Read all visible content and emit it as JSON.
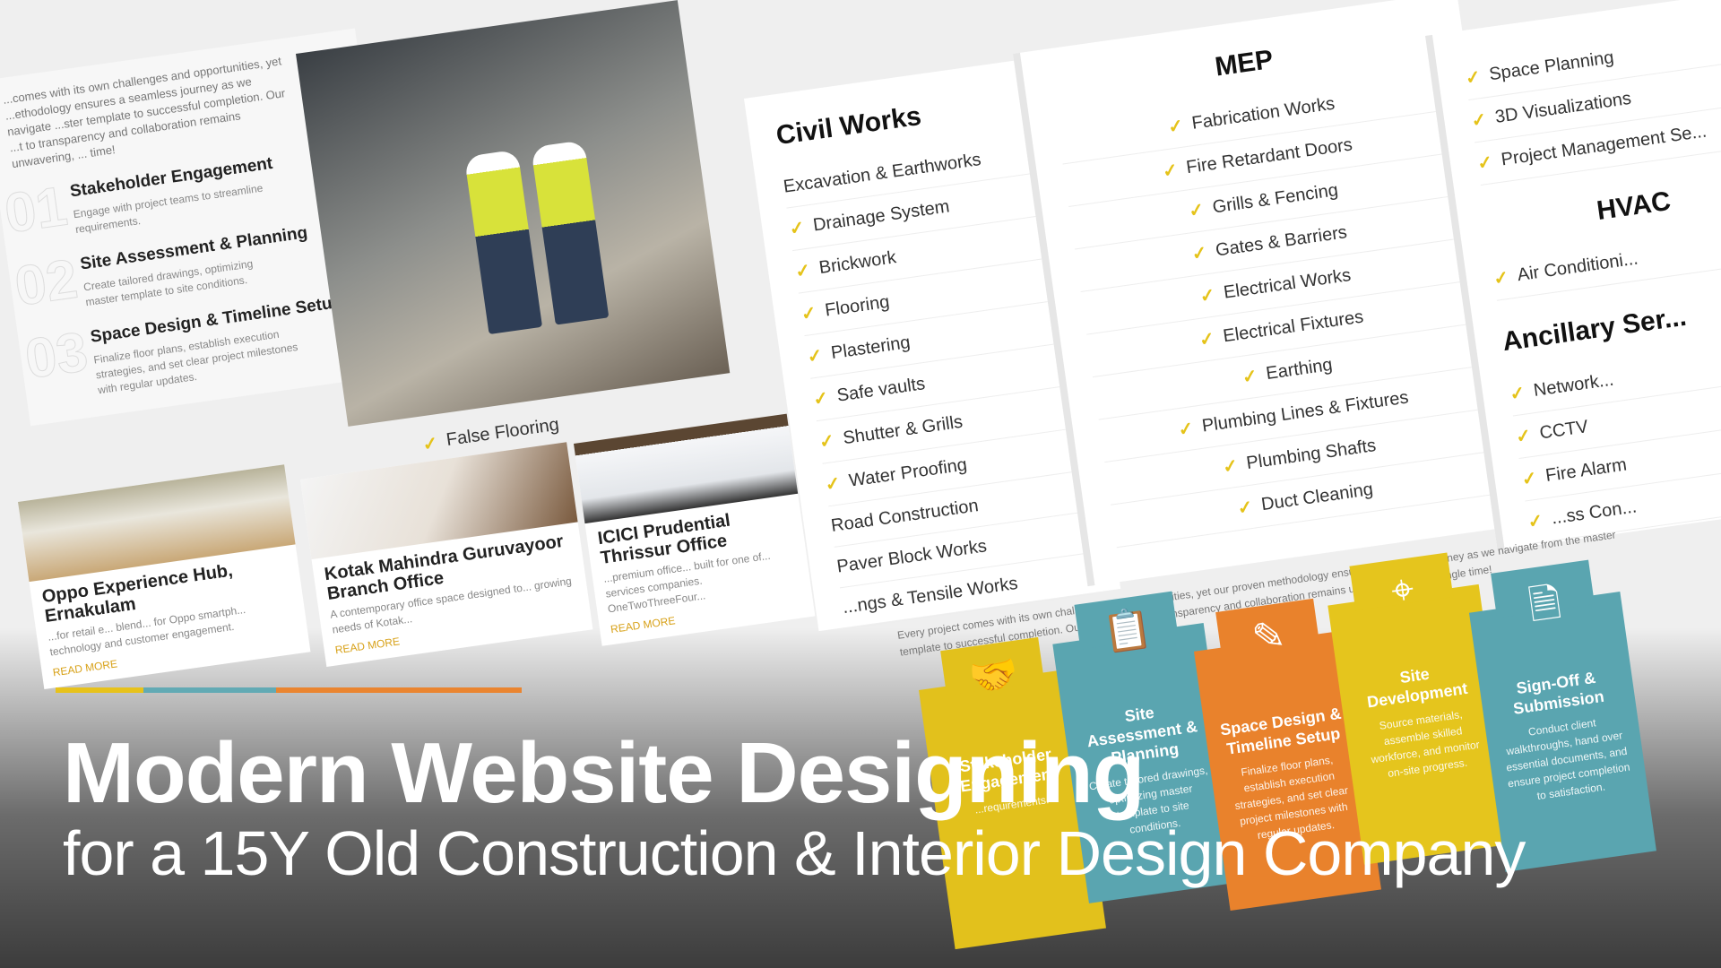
{
  "colors": {
    "yellow": "#e7c21b",
    "teal": "#62aab4",
    "orange": "#ea8530",
    "dark": "#111111"
  },
  "process": {
    "intro": "...comes with its own challenges and opportunities, yet ...ethodology ensures a seamless journey as we navigate ...ster template to successful completion. Our ...t to transparency and collaboration remains unwavering, ... time!",
    "steps": [
      {
        "num": "01",
        "title": "Stakeholder Engagement",
        "desc": "Engage with project teams to streamline requirements."
      },
      {
        "num": "02",
        "title": "Site Assessment & Planning",
        "desc": "Create tailored drawings, optimizing master template to site conditions."
      },
      {
        "num": "03",
        "title": "Space Design & Timeline Setup",
        "desc": "Finalize floor plans, establish execution strategies, and set clear project milestones with regular updates."
      }
    ],
    "partial_item": "False Flooring"
  },
  "civil": {
    "title": "Civil Works",
    "items": [
      {
        "label": "Excavation & Earthworks",
        "check": false
      },
      {
        "label": "Drainage System",
        "check": true
      },
      {
        "label": "Brickwork",
        "check": true
      },
      {
        "label": "Flooring",
        "check": true
      },
      {
        "label": "Plastering",
        "check": true
      },
      {
        "label": "Safe vaults",
        "check": true
      },
      {
        "label": "Shutter & Grills",
        "check": true
      },
      {
        "label": "Water Proofing",
        "check": true
      },
      {
        "label": "Road Construction",
        "check": false
      },
      {
        "label": "Paver Block Works",
        "check": false
      },
      {
        "label": "...ngs & Tensile Works",
        "check": false
      }
    ]
  },
  "mep": {
    "title": "MEP",
    "items": [
      "Fabrication Works",
      "Fire Retardant Doors",
      "Grills & Fencing",
      "Gates & Barriers",
      "Electrical Works",
      "Electrical Fixtures",
      "Earthing",
      "Plumbing Lines & Fixtures",
      "Plumbing Shafts",
      "Duct Cleaning"
    ]
  },
  "right": {
    "items_top": [
      "Space Planning",
      "3D Visualizations",
      "Project Management Se..."
    ],
    "hvac_title": "HVAC",
    "hvac_items": [
      "Air Conditioni..."
    ],
    "ancillary_title": "Ancillary Ser...",
    "ancillary_items": [
      "Network...",
      "CCTV",
      "Fire Alarm",
      "...ss Con..."
    ]
  },
  "methodology_text": "Every project comes with its own challenges and opportunities, yet our proven methodology ensures a seamless journey as we navigate from the master template to successful completion. Our commitment to transparency and collaboration remains unwavering, every single time!",
  "projects": [
    {
      "title": "Oppo Experience Hub, Ernakulam",
      "desc": "...for retail e... blend... for Oppo smartph... technology and customer engagement.",
      "link": "READ MORE"
    },
    {
      "title": "Kotak Mahindra Guruvayoor Branch Office",
      "desc": "A contemporary office space designed to... growing needs of Kotak...",
      "link": "READ MORE"
    },
    {
      "title": "ICICI Prudential Thrissur Office",
      "desc": "...premium office... built for one of... services companies. OneTwoThreeFour...",
      "link": "READ MORE"
    }
  ],
  "process_tabs": [
    {
      "title": "Stakeholder Engagement",
      "desc": "...requirements.",
      "icon": "handshake-icon",
      "color": "#e2c11c"
    },
    {
      "title": "Site Assessment & Planning",
      "desc": "Create tailored drawings, optimizing master template to site conditions.",
      "icon": "checklist-icon",
      "color": "#5aa5b0"
    },
    {
      "title": "Space Design & Timeline Setup",
      "desc": "Finalize floor plans, establish execution strategies, and set clear project milestones with regular updates.",
      "icon": "blueprint-icon",
      "color": "#e9822c"
    },
    {
      "title": "Site Development",
      "desc": "Source materials, assemble skilled workforce, and monitor on-site progress.",
      "icon": "site-map-icon",
      "color": "#e5c51d"
    },
    {
      "title": "Sign-Off & Submission",
      "desc": "Conduct client walkthroughs, hand over essential documents, and ensure project completion to satisfaction.",
      "icon": "document-icon",
      "color": "#5aa5b0"
    }
  ],
  "headline": "Modern Website Designing",
  "subheadline": "for a 15Y Old Construction & Interior Design Company"
}
